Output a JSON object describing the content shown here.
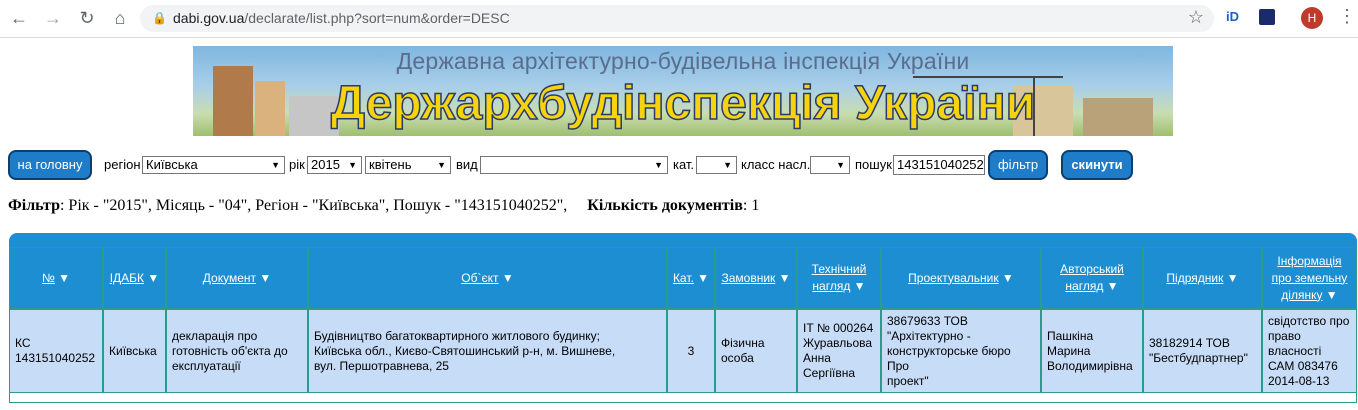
{
  "browser": {
    "url_host": "dabi.gov.ua",
    "url_path": "/declarate/list.php?sort=num&order=DESC",
    "avatar_letter": "H",
    "ext_label": "iD",
    "icons": [
      "back-icon",
      "forward-icon",
      "reload-icon",
      "home-icon",
      "lock-icon",
      "star-icon",
      "menu-icon"
    ]
  },
  "banner": {
    "subtitle": "Державна архітектурно-будівельна інспекція України",
    "title": "Держархбудінспекція України"
  },
  "controls": {
    "home_button": "на головну",
    "region_label": "регіон",
    "region_value": "Київська",
    "year_label": "рік",
    "year_value": "2015",
    "month_value": "квітень",
    "type_label": "вид",
    "type_value": "",
    "cat_label": "кат.",
    "class_label": "класс насл.",
    "search_label": "пошук",
    "search_value": "143151040252",
    "filter_button": "фільтр",
    "reset_button": "скинути"
  },
  "filter_summary": {
    "filter_label": "Фільтр",
    "filter_text": ": Рік - \"2015\", Місяць - \"04\", Регіон - \"Київська\", Пошук - \"143151040252\",",
    "count_label": "Кількість документів",
    "count_value": ": 1"
  },
  "table": {
    "headers": [
      {
        "line1": "№",
        "line2": "",
        "line3": ""
      },
      {
        "line1": "ІДАБК",
        "line2": "",
        "line3": ""
      },
      {
        "line1": "Документ",
        "line2": "",
        "line3": ""
      },
      {
        "line1": "Об`єкт",
        "line2": "",
        "line3": ""
      },
      {
        "line1": "Кат.",
        "line2": "",
        "line3": ""
      },
      {
        "line1": "Замовник",
        "line2": "",
        "line3": ""
      },
      {
        "line1": "Технічний",
        "line2": "нагляд",
        "line3": ""
      },
      {
        "line1": "Проектувальник",
        "line2": "",
        "line3": ""
      },
      {
        "line1": "Авторський",
        "line2": "нагляд",
        "line3": ""
      },
      {
        "line1": "Підрядник",
        "line2": "",
        "line3": ""
      },
      {
        "line1": "Інформація",
        "line2": "про земельну",
        "line3": "ділянку"
      }
    ],
    "row": [
      [
        "КС",
        "143151040252"
      ],
      [
        "Київська"
      ],
      [
        "декларація про",
        "готовність об'єкта до",
        "експлуатації"
      ],
      [
        "Будівництво багатоквартирного житлового будинку;",
        "Київська обл., Києво-Святошинський р-н, м. Вишневе,",
        "вул. Першотравнева, 25"
      ],
      [
        "3"
      ],
      [
        "Фізична",
        "особа"
      ],
      [
        "ІТ № 000264",
        "Журавльова",
        "Анна",
        "Сергіївна"
      ],
      [
        "38679633 ТОВ",
        "\"Архітектурно -",
        "конструкторське бюро Про",
        "проект\""
      ],
      [
        "Пашкіна",
        "Марина",
        "Володимирівна"
      ],
      [
        "38182914 ТОВ",
        "\"Бестбудпартнер\""
      ],
      [
        "свідотство про",
        "право",
        "власності",
        "САМ 083476",
        "2014-08-13"
      ]
    ]
  },
  "colors": {
    "header_bg": "#1e8ed2",
    "row_bg": "#c7dcf7",
    "button_bg": "#1e7cc8",
    "border": "#2a9c8c"
  }
}
